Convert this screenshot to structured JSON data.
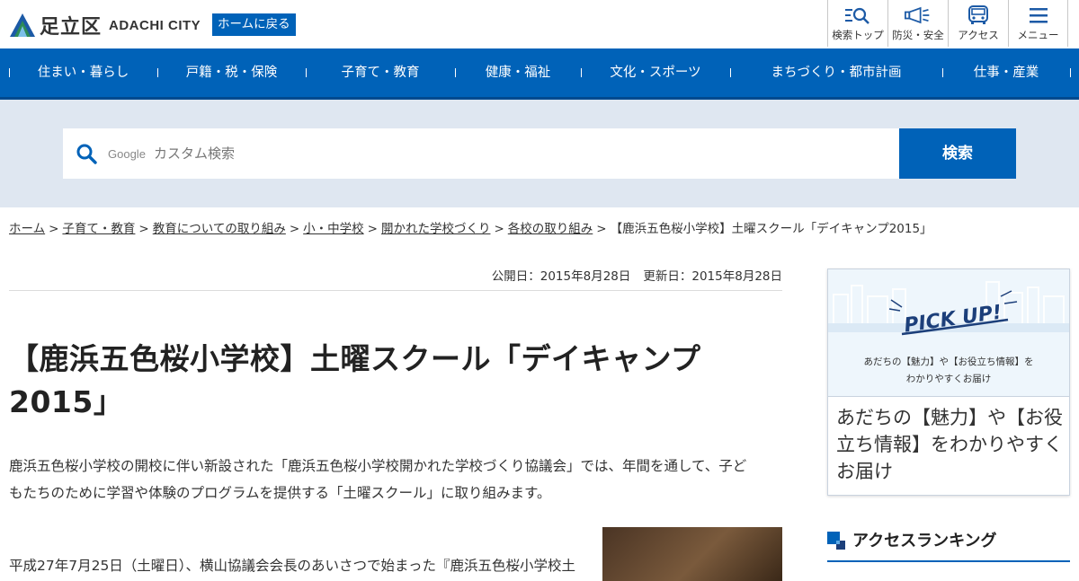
{
  "header": {
    "logo_ja": "足立区",
    "logo_en": "ADACHI CITY",
    "home_button": "ホームに戻る",
    "util_nav": [
      {
        "label": "検索トップ",
        "icon": "search-list-icon"
      },
      {
        "label": "防災・安全",
        "icon": "megaphone-icon"
      },
      {
        "label": "アクセス",
        "icon": "bus-icon"
      },
      {
        "label": "メニュー",
        "icon": "hamburger-menu-icon"
      }
    ]
  },
  "gnav": {
    "items": [
      {
        "label": "住まい・暮らし"
      },
      {
        "label": "戸籍・税・保険"
      },
      {
        "label": "子育て・教育"
      },
      {
        "label": "健康・福祉"
      },
      {
        "label": "文化・スポーツ"
      },
      {
        "label": "まちづくり・都市計画"
      },
      {
        "label": "仕事・産業"
      }
    ]
  },
  "search": {
    "google_mark": "Google",
    "placeholder": "カスタム検索",
    "button": "検索"
  },
  "breadcrumb": {
    "links": [
      "ホーム",
      "子育て・教育",
      "教育についての取り組み",
      "小・中学校",
      "開かれた学校づくり",
      "各校の取り組み"
    ],
    "separator": ">",
    "current": "【鹿浜五色桜小学校】土曜スクール「デイキャンプ2015」"
  },
  "main": {
    "published": "公開日：2015年8月28日",
    "updated": "更新日：2015年8月28日",
    "title_line1": "【鹿浜五色桜小学校】土曜スクール「デイキャンプ",
    "title_line2": "2015」",
    "lead_line1": "鹿浜五色桜小学校の開校に伴い新設された「鹿浜五色桜小学校開かれた学校づくり協議会」では、年間を通して、子ど",
    "lead_line2": "もたちのために学習や体験のプログラムを提供する「土曜スクール」に取り組みます。",
    "body_partial": "平成27年7月25日（土曜日）、横山協議会会長のあいさつで始まった『鹿浜五色桜小学校土"
  },
  "sidebar": {
    "pickup_banner_title": "PICK UP!",
    "pickup_banner_sub_line1": "あだちの【魅力】や【お役立ち情報】を",
    "pickup_banner_sub_line2": "わかりやすくお届け",
    "pickup_text": "あだちの【魅力】や【お役立ち情報】をわかりやすくお届け",
    "ranking_title": "アクセスランキング"
  },
  "colors": {
    "brand_blue": "#0062b8",
    "search_band": "#dfe7f1"
  }
}
